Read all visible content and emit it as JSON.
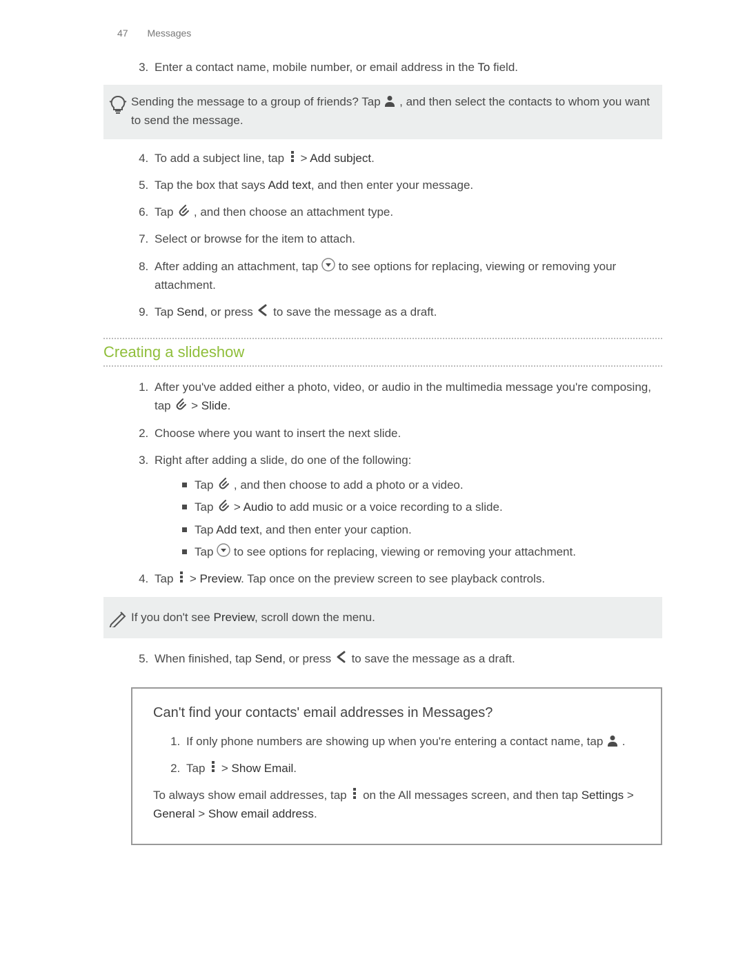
{
  "header": {
    "page_number": "47",
    "section": "Messages"
  },
  "step3": {
    "prefix": "Enter a contact name, mobile number, or email address in the ",
    "to_label": "To",
    "suffix": " field."
  },
  "tip": {
    "prefix": "Sending the message to a group of friends? Tap ",
    "suffix": " , and then select the contacts to whom you want to send the message."
  },
  "step4": {
    "prefix": "To add a subject line, tap ",
    "gt": " > ",
    "add_subject": "Add subject",
    "suffix": "."
  },
  "step5": {
    "prefix": "Tap the box that says ",
    "add_text": "Add text",
    "suffix": ", and then enter your message."
  },
  "step6": {
    "prefix": "Tap ",
    "suffix": " , and then choose an attachment type."
  },
  "step7": "Select or browse for the item to attach.",
  "step8": {
    "prefix": "After adding an attachment, tap ",
    "suffix": " to see options for replacing, viewing or removing your attachment."
  },
  "step9": {
    "prefix": "Tap ",
    "send": "Send",
    "mid": ", or press ",
    "suffix": " to save the message as a draft."
  },
  "slideshow_title": "Creating a slideshow",
  "ss1": {
    "prefix": "After you've added either a photo, video, or audio in the multimedia message you're composing, tap ",
    "gt": " > ",
    "slide": "Slide",
    "suffix": "."
  },
  "ss2": "Choose where you want to insert the next slide.",
  "ss3": {
    "lead": "Right after adding a slide, do one of the following:",
    "b1": {
      "prefix": "Tap ",
      "suffix": " , and then choose to add a photo or a video."
    },
    "b2": {
      "prefix": "Tap ",
      "gt": " > ",
      "audio": "Audio",
      "suffix": " to add music or a voice recording to a slide."
    },
    "b3": {
      "prefix": "Tap ",
      "add_text": "Add text",
      "suffix": ", and then enter your caption."
    },
    "b4": {
      "prefix": "Tap ",
      "suffix": " to see options for replacing, viewing or removing your attachment."
    }
  },
  "ss4": {
    "prefix": "Tap ",
    "gt": " > ",
    "preview": "Preview",
    "suffix": ". Tap once on the preview screen to see playback controls."
  },
  "note": {
    "prefix": "If you don't see ",
    "preview": "Preview",
    "suffix": ", scroll down the menu."
  },
  "ss5": {
    "prefix": "When finished, tap ",
    "send": "Send",
    "mid": ", or press ",
    "suffix": " to save the message as a draft."
  },
  "callout": {
    "title": "Can't find your contacts' email addresses in Messages?",
    "c1": {
      "prefix": "If only phone numbers are showing up when you're entering a contact name, tap ",
      "suffix": " ."
    },
    "c2": {
      "prefix": "Tap ",
      "gt": " > ",
      "show_email": "Show Email",
      "suffix": "."
    },
    "body": {
      "prefix": "To always show email addresses, tap ",
      "mid": " on the All messages screen, and then tap ",
      "settings": "Settings",
      "general": "General",
      "show_email_address": "Show email address",
      "gt": " > ",
      "suffix": "."
    }
  }
}
